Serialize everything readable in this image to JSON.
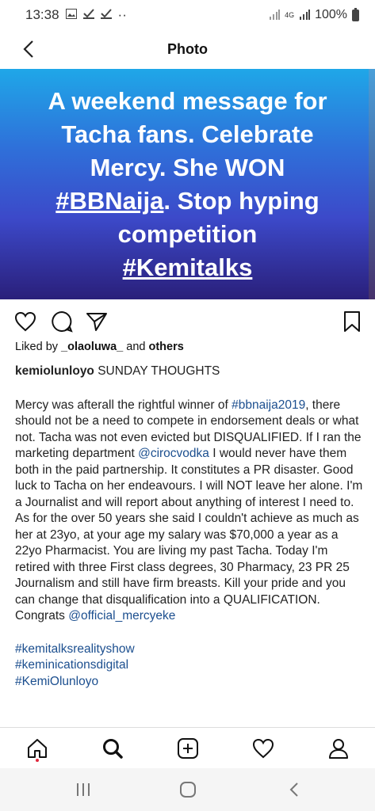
{
  "status_bar": {
    "time": "13:38",
    "dots": "··",
    "network": "4G",
    "battery": "100%"
  },
  "header": {
    "title": "Photo"
  },
  "photo": {
    "line1": "A weekend message for",
    "line2": "Tacha fans. Celebrate",
    "line3": "Mercy. She WON",
    "hash1": "#BBNaija",
    "line4_rest": ". Stop hyping",
    "line5": "competition",
    "hash2": "#Kemitalks"
  },
  "likes": {
    "prefix": "Liked by",
    "user": "_olaoluwa_",
    "and": "and",
    "others": "others"
  },
  "post": {
    "username": "kemiolunloyo",
    "title": "SUNDAY THOUGHTS",
    "p1": "Mercy was afterall the rightful winner of",
    "tag_bbnaija": "#bbnaija2019",
    "p2": ", there should not be a need to compete in endorsement deals or what not. Tacha was not even evicted but DISQUALIFIED. If I ran the marketing department",
    "mention_ciroc": "@cirocvodka",
    "p3": "I would never have them both in the paid partnership. It constitutes a PR disaster. Good luck to Tacha on her endeavours. I will NOT leave her alone. I'm a Journalist and will report about anything of interest I need to. As for the over 50 years she said I couldn't achieve as much as her at 23yo, at your age my salary was $70,000 a year as a 22yo Pharmacist. You are living my past Tacha. Today I'm retired with three First class degrees, 30 Pharmacy, 23 PR 25 Journalism and still have firm breasts. Kill your pride and you can change that disqualification into a QUALIFICATION. Congrats",
    "mention_mercy": "@official_mercyeke",
    "hashtags": [
      "#kemitalksrealityshow",
      "#keminicationsdigital",
      "#KemiOlunloyo"
    ]
  }
}
